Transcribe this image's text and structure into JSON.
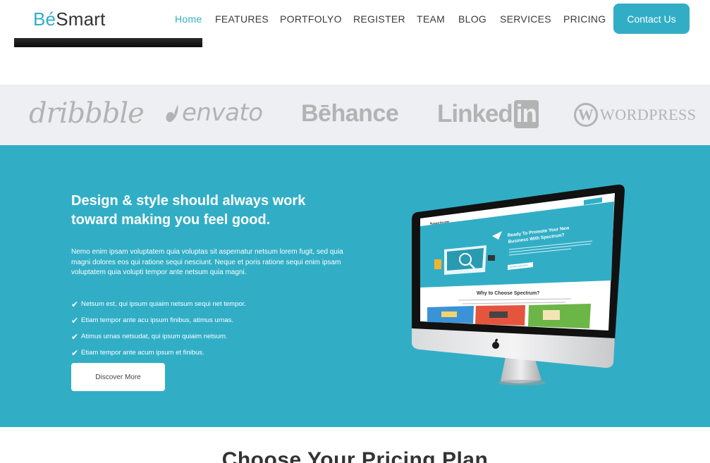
{
  "header": {
    "logo_accent": "Bé",
    "logo_rest": "Smart",
    "nav": [
      {
        "label": "Home",
        "active": true
      },
      {
        "label": "FEATURES",
        "active": false
      },
      {
        "label": "PORTFOLYO",
        "active": false
      },
      {
        "label": "REGISTER",
        "active": false
      },
      {
        "label": "TEAM",
        "active": false
      },
      {
        "label": "BLOG",
        "active": false
      },
      {
        "label": "SERVICES",
        "active": false
      },
      {
        "label": "PRICING",
        "active": false
      }
    ],
    "contact_label": "Contact Us"
  },
  "brands": {
    "dribbble": "dribbble",
    "envato": "envato",
    "behance": "Bēhance",
    "linkedin_text": "Linked",
    "linkedin_box": "in",
    "wordpress_mark": "W",
    "wordpress_text": "WORDPRESS"
  },
  "hero": {
    "title_line1": "Design & style should always work",
    "title_line2": "toward making you feel good.",
    "paragraph": "Nemo enim ipsam voluptatem quia voluptas sit aspernatur netsum lorem fugit, sed quia magni dolores eos qui ratione sequi nesciunt. Neque et poris ratione sequi enim ipsam voluptatem quia volupti tempor ante netsum quia magni.",
    "checklist": [
      "Netsum est, qui ipsum quiaim netsum sequi net tempor.",
      "Etiam tempor ante acu ipsum finibus, atimus urnas.",
      "Atimus urnas netsudat, qui ipsum quiaim netsum.",
      "Etiam tempor ante acum ipsum et finibus."
    ],
    "button_label": "Discover More",
    "screen": {
      "brand": "Spectrum",
      "headline_line1": "Ready To Promote Your New",
      "headline_line2": "Business With Spectrum?",
      "cta": "DOWNLOAD NOW",
      "section_title": "Why to Choose Spectrum?"
    }
  },
  "pricing": {
    "title": "Choose Your Pricing Plan"
  },
  "colors": {
    "accent": "#31aec6",
    "brand_gray": "#b3b3b3",
    "strip_bg": "#eeeff2"
  }
}
